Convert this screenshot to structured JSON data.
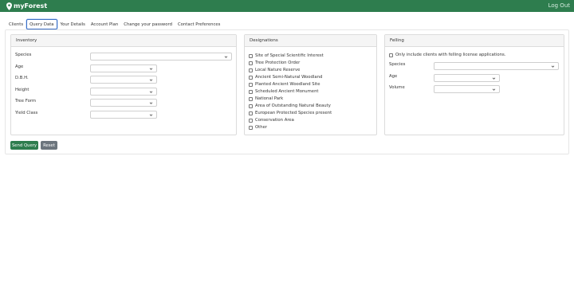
{
  "header": {
    "brand": "myForest",
    "logout_label": "Log Out",
    "brand_color": "#2e7d4e"
  },
  "tabs": [
    {
      "label": "Clients"
    },
    {
      "label": "Query Data",
      "active": true
    },
    {
      "label": "Your Details"
    },
    {
      "label": "Account Plan"
    },
    {
      "label": "Change your password"
    },
    {
      "label": "Contact Preferences"
    }
  ],
  "inventory": {
    "title": "Inventory",
    "fields": [
      {
        "label": "Species",
        "value": ""
      },
      {
        "label": "Age",
        "value": ""
      },
      {
        "label": "D.B.H.",
        "value": ""
      },
      {
        "label": "Height",
        "value": ""
      },
      {
        "label": "Tree Form",
        "value": ""
      },
      {
        "label": "Yield Class",
        "value": ""
      }
    ]
  },
  "designations": {
    "title": "Designations",
    "options": [
      {
        "label": "Site of Special Scientific Interest",
        "checked": false
      },
      {
        "label": "Tree Protection Order",
        "checked": false
      },
      {
        "label": "Local Nature Reserve",
        "checked": false
      },
      {
        "label": "Ancient Semi-Natural Woodland",
        "checked": false
      },
      {
        "label": "Planted Ancient Woodland Site",
        "checked": false
      },
      {
        "label": "Scheduled Ancient Monument",
        "checked": false
      },
      {
        "label": "National Park",
        "checked": false
      },
      {
        "label": "Area of Outstanding Natural Beauty",
        "checked": false
      },
      {
        "label": "European Protected Species present",
        "checked": false
      },
      {
        "label": "Conservation Area",
        "checked": false
      },
      {
        "label": "Other",
        "checked": false
      }
    ]
  },
  "felling": {
    "title": "Felling",
    "only_license_label": "Only include clients with felling license applications.",
    "only_license_checked": false,
    "fields": [
      {
        "label": "Species",
        "value": ""
      },
      {
        "label": "Age",
        "value": ""
      },
      {
        "label": "Volume",
        "value": ""
      }
    ]
  },
  "actions": {
    "send_label": "Send Query",
    "reset_label": "Reset"
  }
}
